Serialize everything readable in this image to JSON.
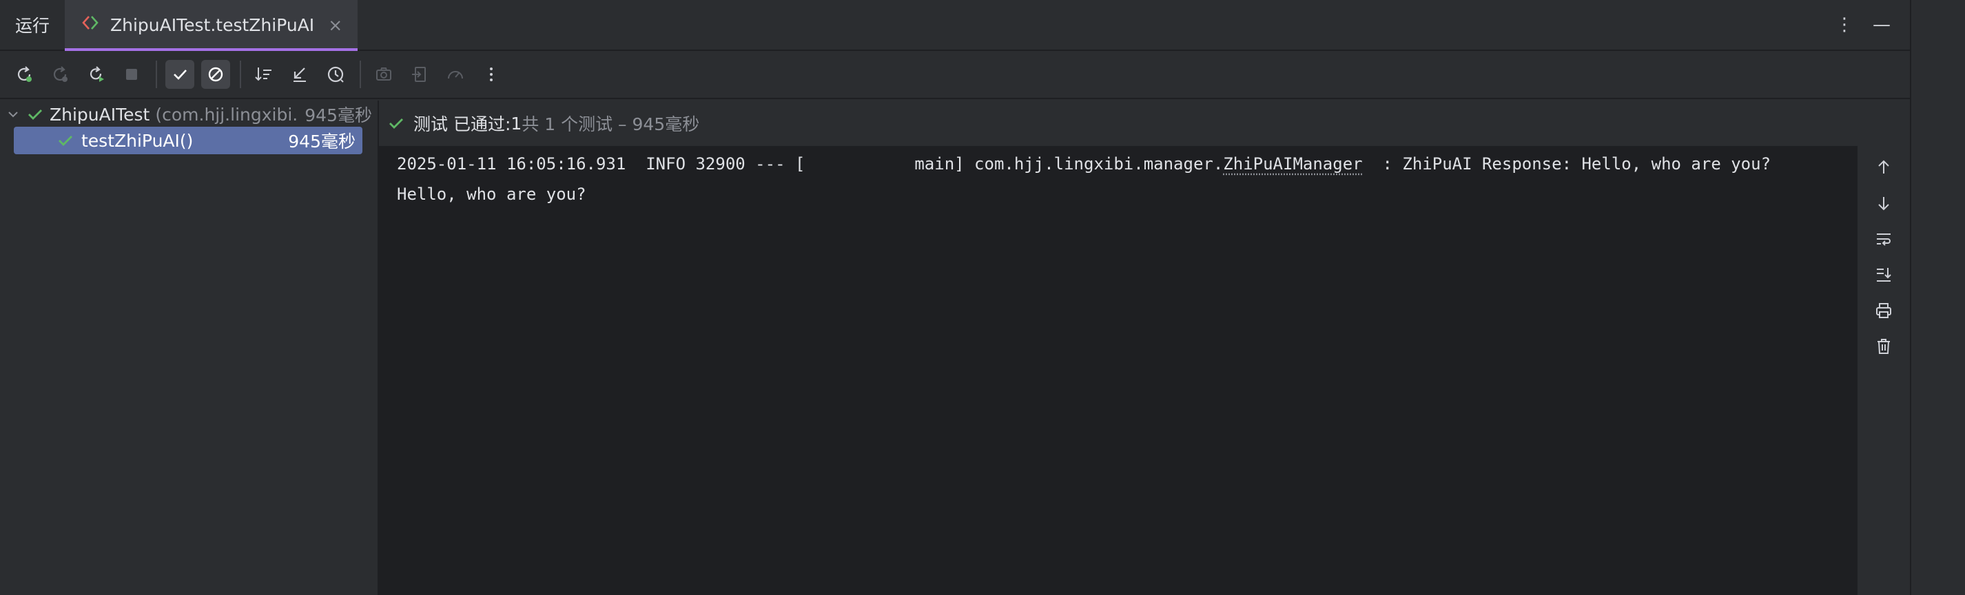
{
  "tabbar": {
    "tool_title": "运行",
    "run_tab_label": "ZhipuAITest.testZhiPuAI",
    "close_glyph": "×",
    "more_glyph": "⋮",
    "minimize_glyph": "—"
  },
  "toolbar": {
    "buttons": [
      {
        "icon": "rerun-icon",
        "enabled": true
      },
      {
        "icon": "rerun-failed-icon",
        "enabled": false
      },
      {
        "icon": "toggle-auto-test-icon",
        "enabled": true
      },
      {
        "icon": "stop-icon",
        "enabled": false
      },
      {
        "icon": "show-passed-icon",
        "enabled": true,
        "active": true
      },
      {
        "icon": "show-ignored-icon",
        "enabled": true,
        "active": true
      },
      {
        "icon": "sort-alphabetically-icon",
        "enabled": true
      },
      {
        "icon": "sort-by-duration-icon",
        "enabled": true
      },
      {
        "icon": "test-history-icon",
        "enabled": true
      },
      {
        "icon": "screenshot-icon",
        "enabled": false
      },
      {
        "icon": "import-tests-icon",
        "enabled": false
      },
      {
        "icon": "coverage-icon",
        "enabled": false
      },
      {
        "icon": "more-icon",
        "enabled": true
      }
    ]
  },
  "tree": {
    "root": {
      "name": "ZhipuAITest",
      "package": "(com.hjj.lingxibi.m",
      "time": "945毫秒"
    },
    "child": {
      "name": "testZhiPuAI()",
      "time": "945毫秒"
    }
  },
  "status": {
    "passed_label": "测试 已通过: ",
    "passed_count": "1",
    "total_text": "共 1 个测试 – 945毫秒"
  },
  "console": {
    "line1_prefix": "2025-01-11 16:05:16.931  INFO 32900 --- [           main] com.hjj.lingxibi.manager.",
    "line1_class": "ZhiPuAIManager",
    "line1_suffix": "  : ZhiPuAI Response: Hello, who are you?",
    "line2": "Hello, who are you?"
  },
  "colors": {
    "accent": "#a571e6",
    "success": "#5fb865",
    "selection": "#5c6fa6",
    "console_bg": "#1e1f22",
    "panel_bg": "#2b2d30"
  }
}
